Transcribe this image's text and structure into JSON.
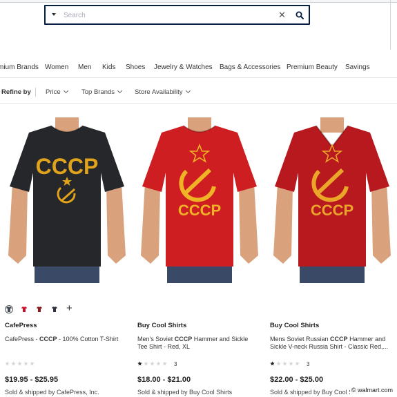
{
  "search": {
    "placeholder": "Search",
    "clear_icon": "close-icon",
    "submit_icon": "search-icon"
  },
  "nav": [
    "mium Brands",
    "Women",
    "Men",
    "Kids",
    "Shoes",
    "Jewelry & Watches",
    "Bags & Accessories",
    "Premium Beauty",
    "Savings"
  ],
  "refine": {
    "label": "Refine by",
    "filters": [
      "Price",
      "Top Brands",
      "Store Availability"
    ]
  },
  "swatches": {
    "colors": [
      "#444a55",
      "#c8142a",
      "#8b1a1f",
      "#2d3340"
    ],
    "selected": 0,
    "more": "+"
  },
  "products": [
    {
      "shirt_color": "#25272b",
      "print_color": "#e1a31c",
      "print_text": "CCCP",
      "brand": "CafePress",
      "title_before": "CafePress - ",
      "title_bold": "CCCP",
      "title_after": " - 100% Cotton T-Shirt",
      "rating": 0,
      "review_count": "",
      "price": "$19.95 - $25.95",
      "seller": "Sold & shipped by CafePress, Inc."
    },
    {
      "shirt_color": "#cf1e22",
      "print_color": "#f0b325",
      "print_text": "CCCP",
      "brand": "Buy Cool Shirts",
      "title_before": "Men's Soviet ",
      "title_bold": "CCCP",
      "title_after": " Hammer and Sickle Tee Shirt - Red, XL",
      "rating": 1,
      "review_count": "3",
      "price": "$18.00 - $21.00",
      "seller": "Sold & shipped by Buy Cool Shirts"
    },
    {
      "shirt_color": "#b8191f",
      "print_color": "#eba62a",
      "print_text": "CCCP",
      "brand": "Buy Cool Shirts",
      "title_before": "Mens Soviet Russian ",
      "title_bold": "CCCP",
      "title_after": " Hammer and Sickle V-neck Russia Shirt - Classic Red,...",
      "rating": 1,
      "review_count": "3",
      "price": "$22.00 - $25.00",
      "seller": "Sold & shipped by Buy Cool Shirts"
    }
  ],
  "watermark": "© walmart.com"
}
